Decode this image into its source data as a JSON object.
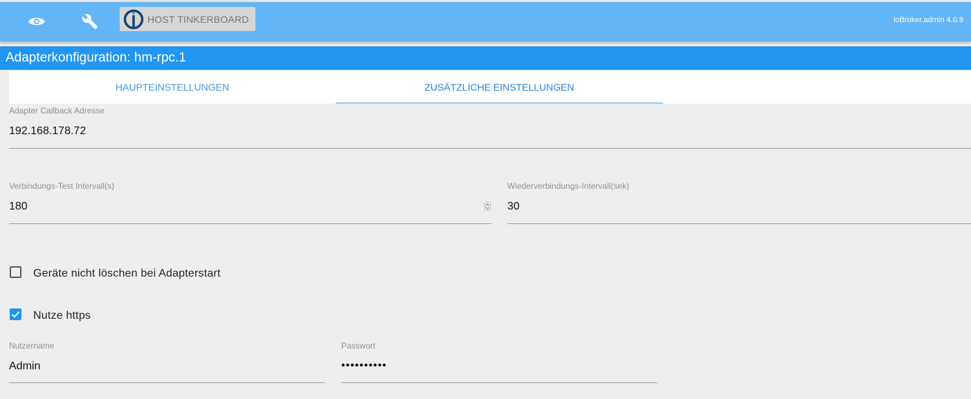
{
  "header": {
    "host_button_label": "HOST TINKERBOARD",
    "version": "ioBroker.admin 4.0.9",
    "icons": [
      "eye-icon",
      "wrench-icon",
      "iobroker-logo-icon"
    ]
  },
  "title": "Adapterkonfiguration: hm-rpc.1",
  "tabs": [
    {
      "label": "HAUPTEINSTELLUNGEN",
      "active": false
    },
    {
      "label": "ZUSÄTZLICHE EINSTELLUNGEN",
      "active": true
    }
  ],
  "fields": {
    "callback": {
      "label": "Adapter Callback Adresse",
      "value": "192.168.178.72"
    },
    "check_interval": {
      "label": "Verbindungs-Test Intervall(s)",
      "value": "180"
    },
    "reconnect_interval": {
      "label": "Wiederverbindungs-Intervall(sek)",
      "value": "30"
    },
    "username": {
      "label": "Nutzername",
      "value": "Admin"
    },
    "password": {
      "label": "Passwort",
      "value": "••••••••••"
    }
  },
  "checkboxes": {
    "dont_delete": {
      "label": "Geräte nicht löschen bei Adapterstart",
      "checked": false
    },
    "use_https": {
      "label": "Nutze https",
      "checked": true
    }
  },
  "colors": {
    "header": "#64b5f6",
    "title_bar": "#2196f3",
    "accent": "#2196f3",
    "background": "#eeeeee"
  }
}
